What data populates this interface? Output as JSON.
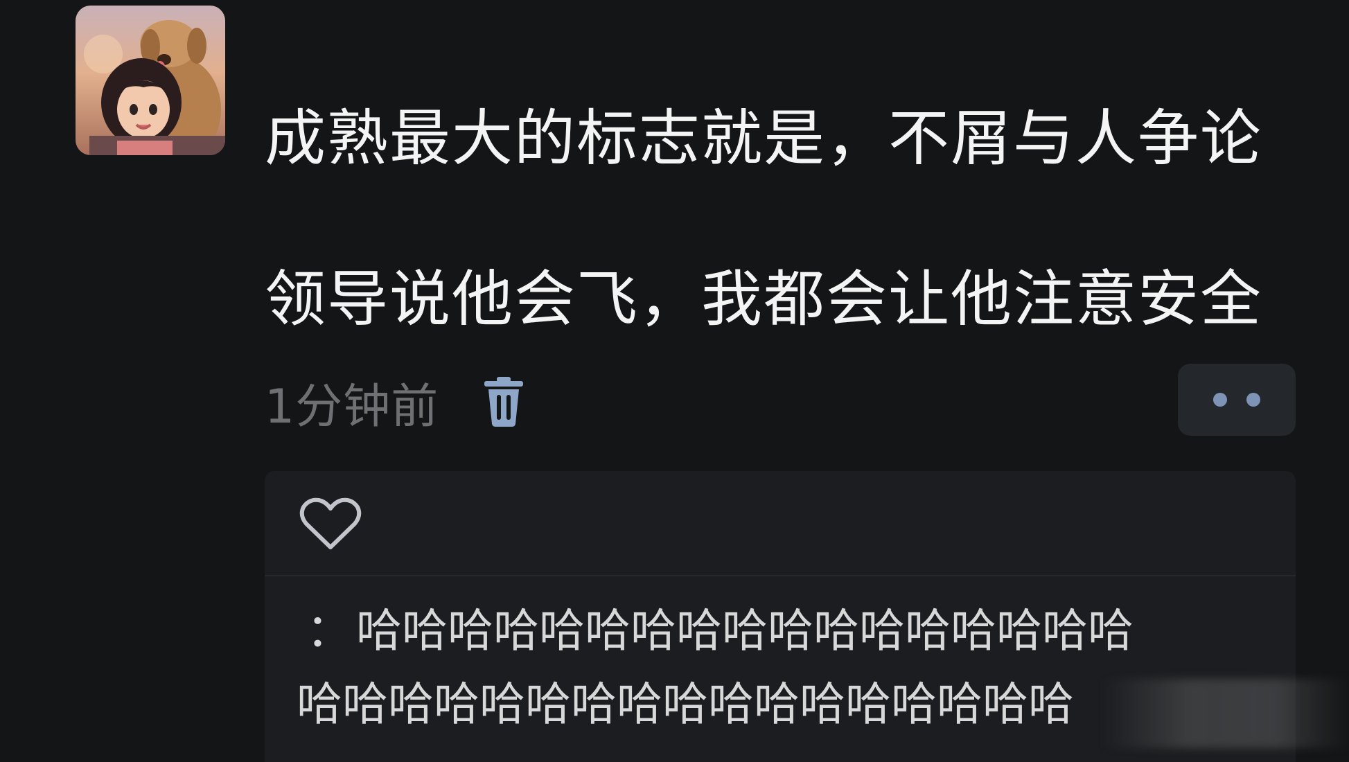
{
  "post": {
    "avatar_icon": "avatar-girl-with-dog",
    "text_line1": "成熟最大的标志就是，不屑与人争论",
    "text_line2": "领导说他会飞，我都会让他注意安全",
    "timestamp": "1分钟前",
    "delete_icon": "trash-icon",
    "more_icon": "more-dots-icon"
  },
  "interactions": {
    "like_icon": "heart-outline-icon",
    "comment": {
      "author_separator": "：",
      "line1": "哈哈哈哈哈哈哈哈哈哈哈哈哈哈哈哈哈",
      "line2": "哈哈哈哈哈哈哈哈哈哈哈哈哈哈哈哈哈"
    }
  },
  "colors": {
    "background": "#141516",
    "panel": "#1b1d20",
    "accent": "#7e94b6",
    "muted_text": "#6f7073"
  }
}
